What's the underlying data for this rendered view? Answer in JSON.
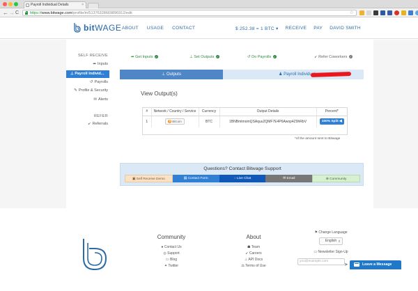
{
  "browser": {
    "tab_title": "Payroll Individual Details",
    "tab_close": "×",
    "url_scheme": "https://",
    "url_host": "www.bitwage.com",
    "url_path": "/profile/in/51376328669896912/edit",
    "nav": {
      "back": "←",
      "forward": "→",
      "reload": "C"
    },
    "menu": "≡"
  },
  "header": {
    "logo_bold": "bit",
    "logo_light": "WAGE",
    "nav": [
      "ABOUT",
      "USAGE",
      "CONTACT"
    ],
    "right": {
      "rate": "$ 252.38 = 1 BTC ▾",
      "receive": "RECEIVE",
      "pay": "PAY",
      "user": "DAVID SMITH"
    }
  },
  "sidebar": {
    "section1": "SELF RECEIVE",
    "inputs": "Inputs",
    "active": "Payroll Individ...",
    "payrolls": "Payrolls",
    "profile": "Profile & Security",
    "alerts": "Alerts",
    "section2": "REFER",
    "referrals": "Referrals"
  },
  "steps": {
    "get_inputs": "Get Inputs",
    "set_outputs": "Set Outputs",
    "do_payrolls": "Do Payrolls",
    "refer": "Refer Coworkers"
  },
  "tabs": {
    "outputs": "Outputs",
    "payroll": "Payroll Individual"
  },
  "view": {
    "title": "View Output(s)",
    "columns": [
      "#",
      "Network / Country / Service",
      "Currency",
      "Output Details",
      "Percent*"
    ],
    "rows": [
      {
        "num": "1",
        "service": "Bitcoin",
        "currency": "BTC",
        "details": "1BNBmtmomQSAquu2QMF7E4P6Awop4Z9hRbV",
        "percent": "100% Split ◀"
      }
    ],
    "note": "*of the amount sent to Bitwage"
  },
  "support": {
    "title": "Questions? Contact Bitwage Support",
    "buttons": [
      "Self Receive Demo",
      "Contact Form",
      "Live Chat",
      "Email",
      "Community"
    ]
  },
  "footer": {
    "community": {
      "title": "Community",
      "links": [
        "Contact Us",
        "Support",
        "Blog",
        "Twitter"
      ]
    },
    "about": {
      "title": "About",
      "links": [
        "Team",
        "Careers",
        "API Docs",
        "Terms of Use"
      ]
    },
    "lang_label": "Change Language",
    "lang_value": "English",
    "newsletter_label": "Newsletter Sign-Up",
    "email_placeholder": "you@example.com",
    "leave_message": "Leave a Message"
  },
  "colors": {
    "brand_blue": "#2b6aa6",
    "active_blue": "#2f7fd4",
    "success_green": "#2e8b3e",
    "redaction_red": "#e8191e"
  }
}
